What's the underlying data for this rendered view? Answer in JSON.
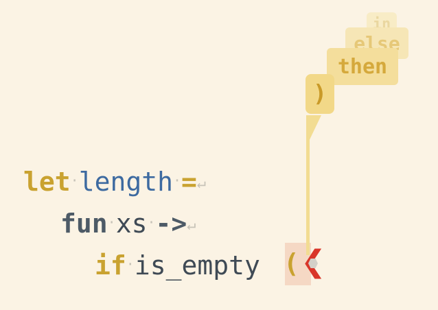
{
  "editor": {
    "line1": {
      "keyword": "let",
      "name": "length",
      "operator": "="
    },
    "line2": {
      "keyword": "fun",
      "param": "xs",
      "arrow": "->"
    },
    "line3": {
      "keyword": "if",
      "call": "is_empty",
      "open_paren": "("
    },
    "whitespace_dot": "·",
    "newline_glyph": "↵"
  },
  "suggestions": {
    "items": [
      ")",
      "then",
      "else",
      "in"
    ]
  },
  "cursor": {
    "caret_glyph": "❮"
  }
}
